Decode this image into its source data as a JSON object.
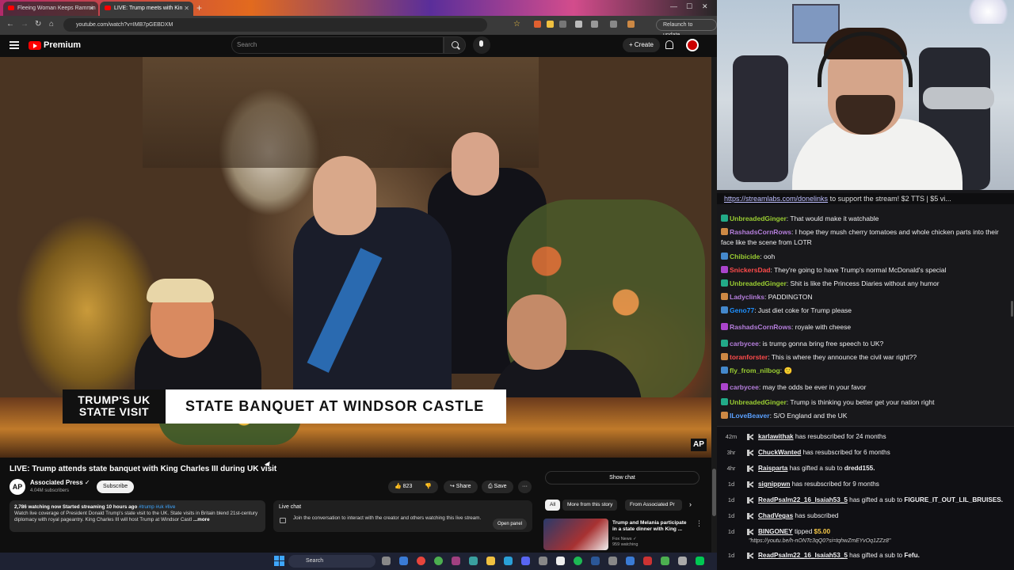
{
  "browser": {
    "tabs": [
      {
        "label": "Fleeing Woman Keeps Rammin"
      },
      {
        "label": "LIVE: Trump meets with Kin"
      }
    ],
    "new_tab_label": "+",
    "url": "youtube.com/watch?v=IMB7pGEBDXM",
    "relaunch_label": "Relaunch to update"
  },
  "youtube": {
    "logo_text": "Premium",
    "search_placeholder": "Search",
    "create_label": "+ Create",
    "lower_third_left": "TRUMP'S UK STATE VISIT",
    "lower_third_right": "STATE BANQUET AT WINDSOR CASTLE",
    "ap_bug": "AP",
    "video_title": "LIVE: Trump attends state banquet with King Charles III during UK visit",
    "channel_initials": "AP",
    "channel_name": "Associated Press ✓",
    "subscribers": "4.04M subscribers",
    "subscribe_label": "Subscribe",
    "like_count": "👍 823",
    "dislike": "👎",
    "share_label": "↪ Share",
    "save_label": "⎙ Save",
    "more_label": "···",
    "description": {
      "meta": "2,786 watching now  Started streaming 10 hours ago",
      "tags": "#trump #uk #live",
      "text": "Watch live coverage of President Donald Trump's state visit to the UK. State visits in Britain blend 21st-century diplomacy with royal pageantry. King Charles III will host Trump at Windsor Castl",
      "more": "...more"
    },
    "live_chat": {
      "title": "Live chat",
      "text": "Join the conversation to interact with the creator and others watching this live stream.",
      "open_panel": "Open panel"
    },
    "show_chat": "Show chat",
    "chips": [
      "All",
      "More from this story",
      "From Associated Pr"
    ],
    "chip_next": "›",
    "recommendation": {
      "title": "Trump and Melania participate in a state dinner with King ...",
      "channel": "Fox News ✓",
      "views": "959 watching"
    }
  },
  "taskbar": {
    "search_label": "Search"
  },
  "chat": {
    "ticker": {
      "link": "https://streamlabs.com/donelinks",
      "text": " to support the stream! $2 TTS | $5 vi..."
    },
    "messages": [
      {
        "user": "UnbreadedGinger",
        "color": "#9acd32",
        "text": "That would make it watchable"
      },
      {
        "user": "RashadsCornRows",
        "color": "#b57edc",
        "text": "I hope they mush cherry tomatoes and whole chicken parts into their face like the scene from LOTR"
      },
      {
        "user": "Chibicide",
        "color": "#9acd32",
        "text": "ooh"
      },
      {
        "user": "SnickersDad",
        "color": "#ff4b4b",
        "text": "They're going to have Trump's normal McDonald's special"
      },
      {
        "user": "UnbreadedGinger",
        "color": "#9acd32",
        "text": "Shit is like the Princess Diaries without any humor"
      },
      {
        "user": "Ladyclinks",
        "color": "#b57edc",
        "text": "PADDINGTON"
      },
      {
        "user": "Geno77",
        "color": "#1e90ff",
        "text": "Just diet coke for Trump please"
      },
      {
        "user": "RashadsCornRows",
        "color": "#b57edc",
        "text": "royale with cheese"
      },
      {
        "user": "carbycee",
        "color": "#b57edc",
        "text": "is trump gonna bring free speech to UK?"
      },
      {
        "user": "toranforster",
        "color": "#ff4b4b",
        "text": "This is where they announce the civil war right??"
      },
      {
        "user": "fly_from_nilbog",
        "color": "#9acd32",
        "text": "🙂"
      },
      {
        "user": "carbycee",
        "color": "#b57edc",
        "text": "may the odds be ever in your favor"
      },
      {
        "user": "UnbreadedGinger",
        "color": "#9acd32",
        "text": "Trump is thinking you better get your nation right"
      },
      {
        "user": "ILoveBeaver",
        "color": "#5aa0ff",
        "text": "S/O England and the UK"
      }
    ]
  },
  "feed": {
    "events": [
      {
        "time": "42m",
        "user": "karlawithak",
        "text": " has resubscribed for 24 months"
      },
      {
        "time": "3hr",
        "user": "ChuckWanted",
        "text": " has resubscribed for 6 months"
      },
      {
        "time": "4hr",
        "user": "Raisparta",
        "text": " has gifted a sub to ",
        "target": "dredd155."
      },
      {
        "time": "1d",
        "user": "signippwn",
        "text": " has resubscribed for 9 months"
      },
      {
        "time": "1d",
        "user": "ReadPsalm22_16_Isaiah53_5",
        "text": " has gifted a sub to ",
        "target": "FIGURE_IT_OUT_LIL_BRUISES."
      },
      {
        "time": "1d",
        "user": "ChadVegas",
        "text": " has subscribed"
      },
      {
        "time": "1d",
        "user": "BINGONEY",
        "text": " tipped ",
        "amount": "$5.00",
        "note": "\"https://youtu.be/h-nONTc3qQ0?si=tqhwZmEYvOq1ZZz8\""
      },
      {
        "time": "1d",
        "user": "ReadPsalm22_16_Isaiah53_5",
        "text": " has gifted a sub to ",
        "target": "Fefu."
      }
    ]
  }
}
